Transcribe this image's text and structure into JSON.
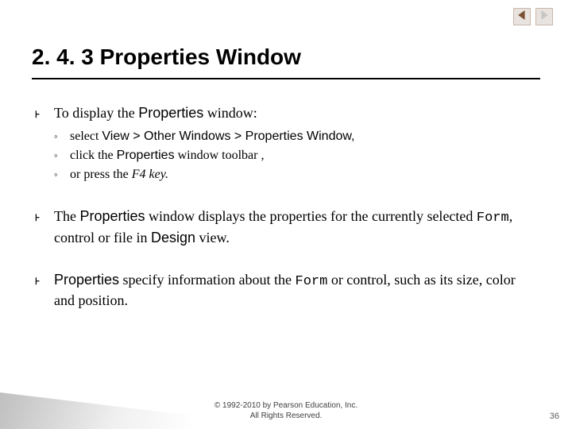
{
  "nav": {
    "prev": "previous-slide",
    "next": "next-slide"
  },
  "title": "2. 4. 3 Properties Window",
  "bullets": [
    {
      "prefix": "To display the ",
      "strong1": "Properties",
      "rest": " window:",
      "subitems": [
        {
          "t1": "select ",
          "s1": "View > Other Windows > Properties Window,",
          "t2": ""
        },
        {
          "t1": "click the ",
          "s1": "Properties",
          "t2": " window toolbar ,"
        },
        {
          "t1": "or press the ",
          "i1": "F4 key.",
          "t2": ""
        }
      ]
    },
    {
      "text_parts": [
        {
          "t": "The ",
          "cls": ""
        },
        {
          "t": "Properties",
          "cls": "sans"
        },
        {
          "t": " window displays the properties for the currently selected ",
          "cls": ""
        },
        {
          "t": "Form",
          "cls": "mono"
        },
        {
          "t": ", control or file in ",
          "cls": ""
        },
        {
          "t": "Design",
          "cls": "sans"
        },
        {
          "t": " view.",
          "cls": ""
        }
      ]
    },
    {
      "text_parts": [
        {
          "t": "Properties",
          "cls": "sans"
        },
        {
          "t": " specify information about the ",
          "cls": ""
        },
        {
          "t": "Form",
          "cls": "mono"
        },
        {
          "t": " or control, such as its size, color and position.",
          "cls": ""
        }
      ]
    }
  ],
  "copyright_line1": "© 1992-2010 by Pearson Education, Inc.",
  "copyright_line2": "All Rights Reserved.",
  "page_number": "36"
}
